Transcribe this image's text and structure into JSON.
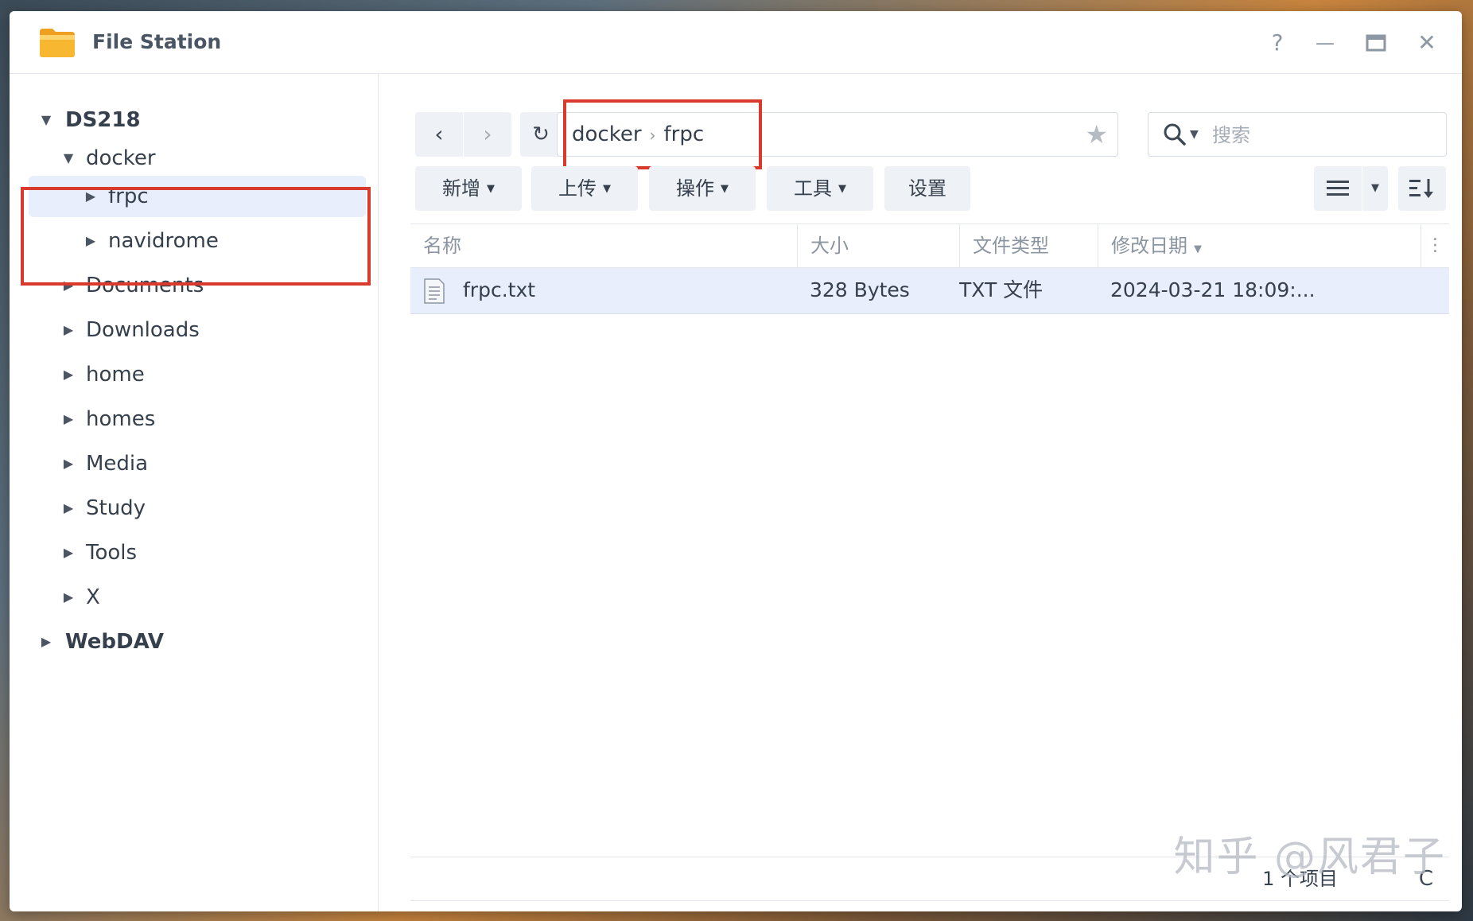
{
  "window": {
    "title": "File Station",
    "icon": "folder-icon",
    "controls": {
      "help": "?",
      "minimize": "—",
      "maximize": "▭",
      "close": "✕"
    }
  },
  "sidebar": {
    "root": "DS218",
    "items": [
      {
        "label": "docker",
        "level": 1,
        "expanded": true
      },
      {
        "label": "frpc",
        "level": 2,
        "selected": true
      },
      {
        "label": "navidrome",
        "level": 2
      },
      {
        "label": "Documents",
        "level": 1
      },
      {
        "label": "Downloads",
        "level": 1
      },
      {
        "label": "home",
        "level": 1
      },
      {
        "label": "homes",
        "level": 1
      },
      {
        "label": "Media",
        "level": 1
      },
      {
        "label": "Study",
        "level": 1
      },
      {
        "label": "Tools",
        "level": 1
      },
      {
        "label": "X",
        "level": 1
      }
    ],
    "root2": "WebDAV"
  },
  "path": {
    "segments": [
      "docker",
      "frpc"
    ]
  },
  "search": {
    "placeholder": "搜索"
  },
  "toolbar": {
    "create": "新增",
    "upload": "上传",
    "action": "操作",
    "tools": "工具",
    "settings": "设置"
  },
  "table": {
    "columns": {
      "name": "名称",
      "size": "大小",
      "type": "文件类型",
      "modified": "修改日期"
    },
    "rows": [
      {
        "name": "frpc.txt",
        "size": "328 Bytes",
        "type": "TXT 文件",
        "modified": "2024-03-21 18:09:..."
      }
    ]
  },
  "footer": {
    "count": "1 个项目",
    "refresh": "C"
  },
  "watermark": "知乎 @风君子",
  "colors": {
    "selection": "#e8eefb",
    "highlight": "#d93a2b",
    "button": "#eef1f5"
  }
}
